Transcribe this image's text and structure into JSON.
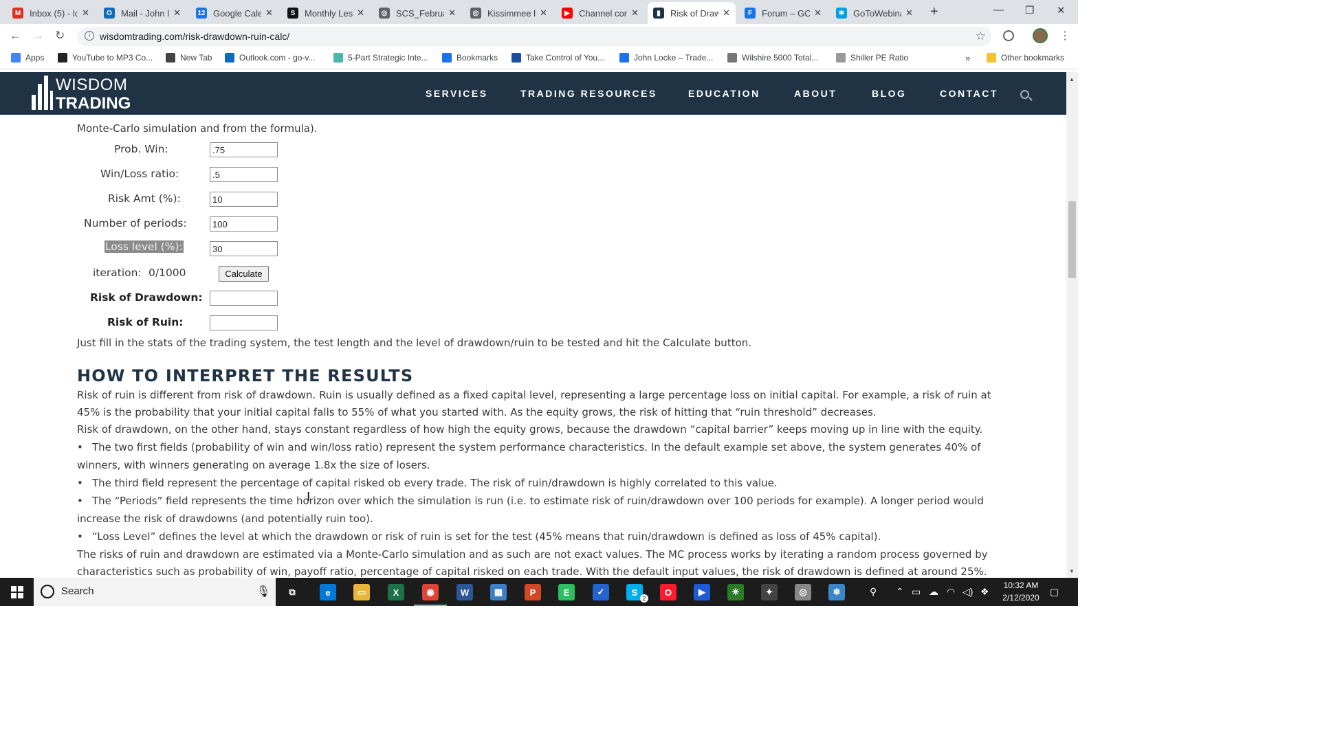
{
  "browser": {
    "tabs": [
      {
        "label": "Inbox (5) - lc",
        "icon": "gmail-icon",
        "color": "#d93025",
        "glyph": "M"
      },
      {
        "label": "Mail - John l",
        "icon": "outlook-icon",
        "color": "#0f6cbd",
        "glyph": "O"
      },
      {
        "label": "Google Cale",
        "icon": "calendar-icon",
        "color": "#1a73e8",
        "glyph": "12"
      },
      {
        "label": "Monthly Les",
        "icon": "scs-icon",
        "color": "#111111",
        "glyph": "S"
      },
      {
        "label": "SCS_Februar",
        "icon": "globe-icon",
        "color": "#5f6368",
        "glyph": "◎"
      },
      {
        "label": "Kissimmee l",
        "icon": "globe-icon",
        "color": "#5f6368",
        "glyph": "◎"
      },
      {
        "label": "Channel con",
        "icon": "youtube-icon",
        "color": "#ff0000",
        "glyph": "▶"
      },
      {
        "label": "Risk of Draw",
        "icon": "wisdom-trading-icon",
        "color": "#1f3345",
        "glyph": "▮"
      },
      {
        "label": "Forum – GO",
        "icon": "forum-icon",
        "color": "#1a73e8",
        "glyph": "F"
      },
      {
        "label": "GoToWebina",
        "icon": "gotowebinar-icon",
        "color": "#00a1e0",
        "glyph": "✻"
      }
    ],
    "url": "wisdomtrading.com/risk-drawdown-ruin-calc/",
    "bookmarks": [
      {
        "label": "Apps",
        "color": "#4285f4"
      },
      {
        "label": "YouTube to MP3 Co...",
        "color": "#222222"
      },
      {
        "label": "New Tab",
        "color": "#444444"
      },
      {
        "label": "Outlook.com - go-v...",
        "color": "#0f6cbd"
      },
      {
        "label": "5-Part Strategic Inte...",
        "color": "#4db6ac"
      },
      {
        "label": "Bookmarks",
        "color": "#1a73e8"
      },
      {
        "label": "Take Control of You...",
        "color": "#1a4fa0"
      },
      {
        "label": "John Locke – Trade...",
        "color": "#1a73e8"
      },
      {
        "label": "Wilshire 5000 Total...",
        "color": "#777777"
      },
      {
        "label": "Shiller PE Ratio",
        "color": "#999999"
      }
    ],
    "bookmarks_more": "»",
    "other_bookmarks": "Other bookmarks"
  },
  "site": {
    "logo_line1": "WISDOM",
    "logo_line2": "TRADING",
    "nav": [
      "SERVICES",
      "TRADING RESOURCES",
      "EDUCATION",
      "ABOUT",
      "BLOG",
      "CONTACT"
    ]
  },
  "calculator": {
    "intro": "Monte-Carlo simulation and from the formula).",
    "fields": [
      {
        "label": "Prob. Win:",
        "value": ".75"
      },
      {
        "label": "Win/Loss ratio:",
        "value": ".5"
      },
      {
        "label": "Risk Amt (%):",
        "value": "10"
      },
      {
        "label": "Number of periods:",
        "value": "100"
      },
      {
        "label": "Loss level (%):",
        "value": "30"
      }
    ],
    "iteration_label": "iteration:",
    "iteration_value": "0/1000",
    "calculate_label": "Calculate",
    "risk_drawdown_label": "Risk of Drawdown:",
    "risk_ruin_label": "Risk of Ruin:",
    "risk_drawdown_value": "",
    "risk_ruin_value": "",
    "instructions": "Just fill in the stats of the trading system, the test length and the level of drawdown/ruin to be tested and hit the Calculate button."
  },
  "interpret": {
    "heading": "HOW TO INTERPRET THE RESULTS",
    "para1_line1": "Risk of ruin is different from risk of drawdown. Ruin is usually defined as a fixed capital level, representing a large percentage loss on initial capital. For example, a risk of ruin at",
    "para1_line2": "45% is the probability that your initial capital falls to 55% of what you started with. As the equity grows, the risk of hitting that “ruin threshold” decreases.",
    "para2": "Risk of drawdown, on the other hand, stays constant regardless of how high the equity grows, because the drawdown “capital barrier” keeps moving up in line with the equity.",
    "bullet1_line1": "The two first fields (probability of win and win/loss ratio) represent the system performance characteristics. In the default example set above, the system generates 40% of",
    "bullet1_line2": "winners, with winners generating on average 1.8x the size of losers.",
    "bullet2": "The third field represent the percentage of capital risked ob every trade. The risk of ruin/drawdown is highly correlated to this value.",
    "bullet3_line1": "The “Periods” field represents the time horizon over which the simulation is run (i.e. to estimate risk of ruin/drawdown over 100 periods for example). A longer period would",
    "bullet3_line2": "increase the risk of drawdowns (and potentially ruin too).",
    "bullet4": "“Loss Level” defines the level at which the drawdown or risk of ruin is set for the test (45% means that ruin/drawdown is defined as loss of 45% capital).",
    "para3_line1": "The risks of ruin and drawdown are estimated via a Monte-Carlo simulation and as such are not exact values. The MC process works by iterating a random process governed by",
    "para3_line2": "characteristics such as probability of win, payoff ratio, percentage of capital risked on each trade. With the default input values, the risk of drawdown is defined at around 25%."
  },
  "taskbar": {
    "search_placeholder": "Search",
    "apps": [
      {
        "name": "task-view-icon",
        "color": "#1c1c1c",
        "glyph": "⧉"
      },
      {
        "name": "edge-icon",
        "color": "#0078d7",
        "glyph": "e"
      },
      {
        "name": "file-explorer-icon",
        "color": "#e8b63a",
        "glyph": "▭"
      },
      {
        "name": "excel-icon",
        "color": "#1e7145",
        "glyph": "X"
      },
      {
        "name": "chrome-icon",
        "color": "#db4437",
        "glyph": "◉"
      },
      {
        "name": "word-icon",
        "color": "#2b579a",
        "glyph": "W"
      },
      {
        "name": "notebook-icon",
        "color": "#3b7fc4",
        "glyph": "▦"
      },
      {
        "name": "powerpoint-icon",
        "color": "#d24726",
        "glyph": "P"
      },
      {
        "name": "evernote-icon",
        "color": "#2dbe60",
        "glyph": "E"
      },
      {
        "name": "todo-icon",
        "color": "#2564cf",
        "glyph": "✓"
      },
      {
        "name": "skype-icon",
        "color": "#00aff0",
        "glyph": "S"
      },
      {
        "name": "opera-icon",
        "color": "#ff1b2d",
        "glyph": "O"
      },
      {
        "name": "media-player-icon",
        "color": "#1f5bd6",
        "glyph": "▶"
      },
      {
        "name": "chart-app-icon",
        "color": "#2a7a2a",
        "glyph": "✳"
      },
      {
        "name": "gear-app-icon",
        "color": "#444444",
        "glyph": "✦"
      },
      {
        "name": "disc-app-icon",
        "color": "#888888",
        "glyph": "◎"
      },
      {
        "name": "snowflake-app-icon",
        "color": "#3a86c8",
        "glyph": "❄"
      }
    ],
    "skype_badge": "2",
    "time": "10:32 AM",
    "date": "2/12/2020"
  }
}
